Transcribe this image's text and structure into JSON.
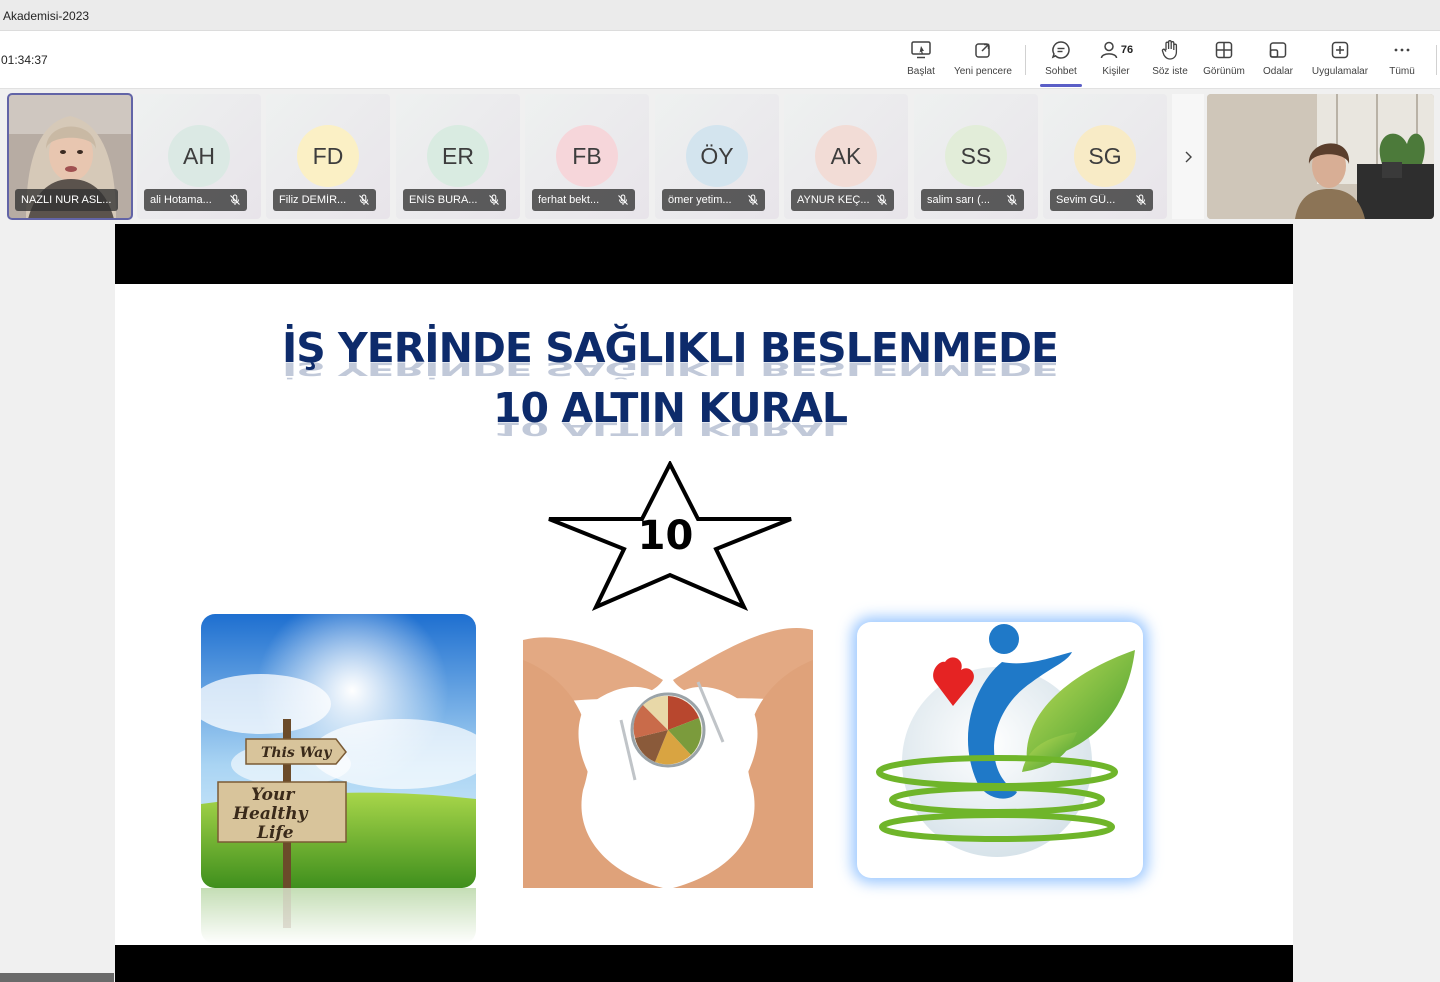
{
  "window": {
    "title": "Akademisi-2023"
  },
  "toolbar": {
    "timer": "01:34:37",
    "buttons": {
      "start": "Başlat",
      "new_window": "Yeni pencere",
      "chat": "Sohbet",
      "people": "Kişiler",
      "people_count": "76",
      "raise_hand": "Söz iste",
      "view": "Görünüm",
      "rooms": "Odalar",
      "apps": "Uygulamalar",
      "more": "Tümü"
    },
    "active_tab": "Sohbet"
  },
  "participants": [
    {
      "name": "NAZLI NUR ASL...",
      "type": "video"
    },
    {
      "initials": "AH",
      "name": "ali Hotama...",
      "avatar_color": "#dbe9e4"
    },
    {
      "initials": "FD",
      "name": "Filiz DEMİR...",
      "avatar_color": "#fbf0c5"
    },
    {
      "initials": "ER",
      "name": "ENİS BURA...",
      "avatar_color": "#d9ebe1"
    },
    {
      "initials": "FB",
      "name": "ferhat bekt...",
      "avatar_color": "#f6d6da"
    },
    {
      "initials": "ÖY",
      "name": "ömer yetim...",
      "avatar_color": "#d3e4ee"
    },
    {
      "initials": "AK",
      "name": "AYNUR KEÇ...",
      "avatar_color": "#f2dcd6"
    },
    {
      "initials": "SS",
      "name": "salim sarı (...",
      "avatar_color": "#e2edd9"
    },
    {
      "initials": "SG",
      "name": "Sevim GÜ...",
      "avatar_color": "#f8ebc6"
    }
  ],
  "slide": {
    "title_line1": "İŞ YERİNDE SAĞLIKLI BESLENMEDE",
    "title_line2": "10 ALTIN KURAL",
    "star_number": "10",
    "sign_top": "This Way",
    "sign_bottom_1": "Your",
    "sign_bottom_2": "Healthy",
    "sign_bottom_3": "Life"
  },
  "colors": {
    "accent": "#5b5fc7",
    "slide_title": "#0d2b6b"
  }
}
